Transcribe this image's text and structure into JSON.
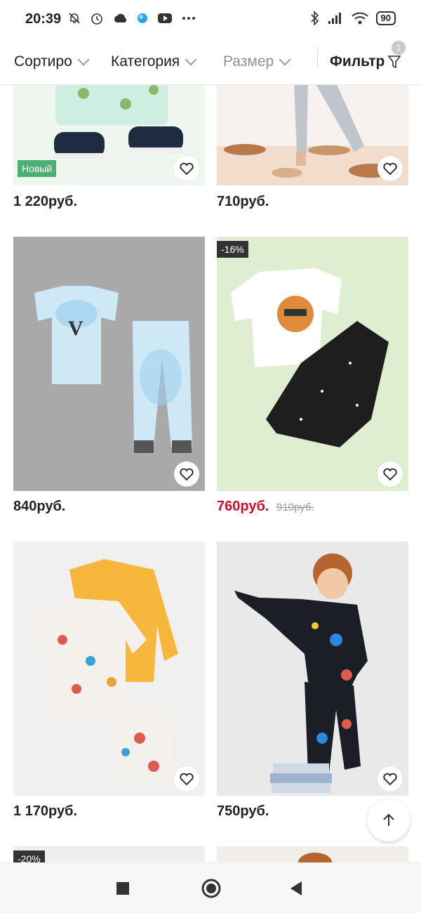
{
  "status_bar": {
    "time": "20:39",
    "battery": "90",
    "icons_left": [
      "mute-bell-icon",
      "alarm-icon",
      "cloud-icon",
      "app-icon",
      "youtube-icon",
      "more-icon"
    ],
    "icons_right": [
      "bluetooth-icon",
      "signal-icon",
      "wifi-icon",
      "battery-icon"
    ]
  },
  "sort_bar": {
    "sort_label": "Сортиро",
    "category_label": "Категория",
    "size_label": "Размер",
    "filter_label": "Фильтр",
    "filter_count": "1"
  },
  "products": [
    {
      "price": "1 220руб.",
      "badge": "Новый",
      "desc": "Pajama with avocado print and sneakers"
    },
    {
      "price": "710руб.",
      "desc": "Child in dinosaur print pants"
    },
    {
      "price": "840руб.",
      "desc": "Tie-dye good night pajama set"
    },
    {
      "price": "760руб.",
      "old_price": "910руб.",
      "badge": "-16%",
      "desc": "Cool tiger tee with black pants"
    },
    {
      "price": "1 170руб.",
      "desc": "Dinosaur print pajama set with yellow top"
    },
    {
      "price": "750руб.",
      "desc": "Boy in space print pajama"
    },
    {
      "badge": "-20%"
    }
  ],
  "colors": {
    "sale_price": "#c8102e",
    "badge_new": "#4caf73",
    "badge_discount": "#333333"
  }
}
